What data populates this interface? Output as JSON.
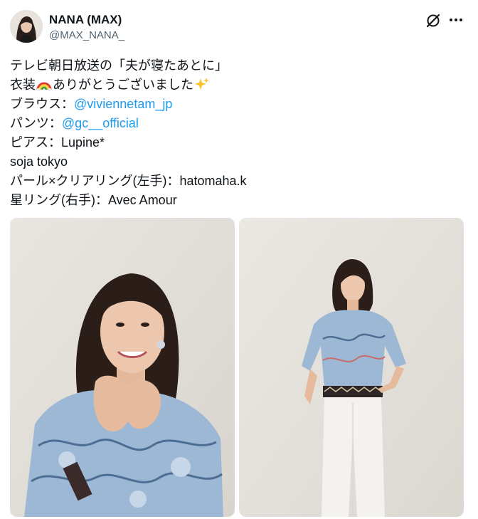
{
  "author": {
    "display_name": "NANA (MAX)",
    "handle": "@MAX_NANA_"
  },
  "header_icons": [
    "grok-icon",
    "more-icon"
  ],
  "tweet": {
    "line1": "テレビ朝日放送の「夫が寝たあとに」",
    "line2_a": "衣装",
    "line2_b": "ありがとうございました",
    "line3_label": "ブラウス：",
    "line3_mention": "@viviennetam_jp",
    "line4_label": "パンツ：",
    "line4_mention": "@gc__official",
    "line5": "ピアス：Lupine*",
    "line6": "soja tokyo",
    "line7": "パール×クリアリング(左手)：hatomaha.k",
    "line8": "星リング(右手)：Avec Amour",
    "emojis": [
      "rainbow-emoji",
      "sparkles-emoji"
    ]
  },
  "colors": {
    "text": "#0f1419",
    "secondary": "#536471",
    "link": "#1d9bf0"
  }
}
